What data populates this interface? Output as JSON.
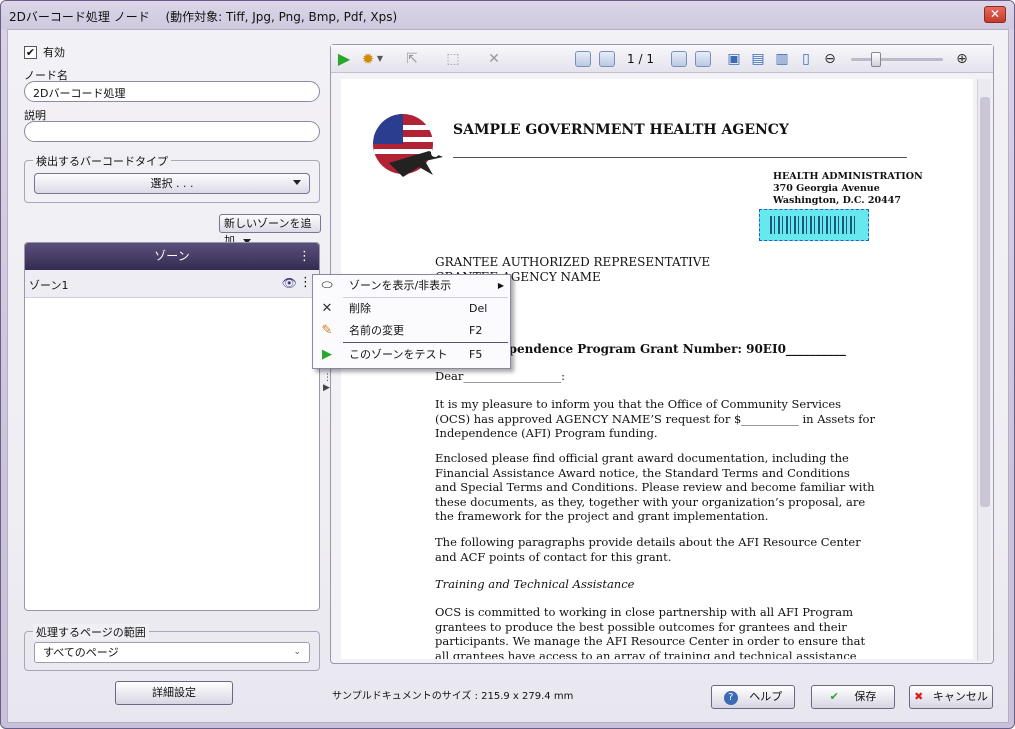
{
  "window": {
    "title": "2Dバーコード処理 ノード　 (動作対象: Tiff, Jpg, Png, Bmp, Pdf, Xps)",
    "close_symbol": "✕"
  },
  "left": {
    "enabled_label": "有効",
    "enabled_checked": true,
    "node_name_label": "ノード名",
    "node_name_value": "2Dバーコード処理",
    "description_label": "説明",
    "description_value": "",
    "barcode_type_group": "検出するバーコードタイプ",
    "barcode_type_select": "選択 . . .",
    "add_zone_button": "新しいゾーンを追加",
    "zone_header": "ゾーン",
    "zones": [
      {
        "name": "ゾーン1"
      }
    ],
    "page_range_group": "処理するページの範囲",
    "page_range_value": "すべてのページ",
    "advanced_button": "詳細設定"
  },
  "viewer": {
    "page_current": "1",
    "page_separator": "/",
    "page_total": "1",
    "icons": [
      "play-icon",
      "settings-icon",
      "pointer-tool-icon",
      "zone-tool-icon",
      "delete-zone-icon",
      "first-page-icon",
      "prev-page-icon",
      "next-page-icon",
      "last-page-icon",
      "image-icon",
      "fit-icon",
      "fit-width-icon",
      "page-icon",
      "zoom-out-icon",
      "zoom-in-icon"
    ]
  },
  "document": {
    "agency_title": "SAMPLE GOVERNMENT HEALTH AGENCY",
    "address_lines": [
      "HEALTH ADMINISTRATION",
      "370 Georgia Avenue",
      "Washington, D.C. 20447"
    ],
    "recipient_lines": [
      "GRANTEE AUTHORIZED REPRESENTATIVE",
      "GRANTEE AGENCY NAME"
    ],
    "subject": "ependence Program Grant Number:  90EI0__________",
    "salutation": "Dear_________________:",
    "para1": "It is my pleasure to inform you that the Office of Community Services (OCS) has approved AGENCY NAME’S  request for $__________ in Assets for Independence (AFI) Program funding.",
    "para2": "Enclosed please find official grant award documentation, including the Financial Assistance Award notice, the Standard Terms and Conditions and Special Terms and Conditions.  Please review and become familiar with these documents, as they, together with your organization’s proposal, are the framework for the project and grant implementation.",
    "para3": "The following paragraphs provide details about the AFI Resource Center and ACF points of contact for this grant.",
    "heading": "Training and Technical Assistance",
    "para4": "OCS is committed to working in close partnership with all AFI Program grantees to produce the best possible outcomes for grantees and their participants.  We manage the AFI Resource Center in order to ensure that all grantees have access to an array of training and technical assistance services and opportunities.   The program webpage at"
  },
  "status": {
    "doc_size": "サンプルドキュメントのサイズ : 215.9 x 279.4 mm"
  },
  "footer": {
    "help_button": "ヘルプ",
    "save_button": "保存",
    "cancel_button": "キャンセル"
  },
  "context_menu": {
    "items": [
      {
        "label": "ゾーンを表示/非表示",
        "shortcut": ""
      },
      {
        "label": "削除",
        "shortcut": "Del"
      },
      {
        "label": "名前の変更",
        "shortcut": "F2"
      },
      {
        "label": "このゾーンをテスト",
        "shortcut": "F5"
      }
    ]
  },
  "colors": {
    "zone_header": "#3f355f",
    "accent_green": "#2aa62a",
    "cancel_red": "#d62020",
    "barcode_highlight": "#66e8ef"
  }
}
